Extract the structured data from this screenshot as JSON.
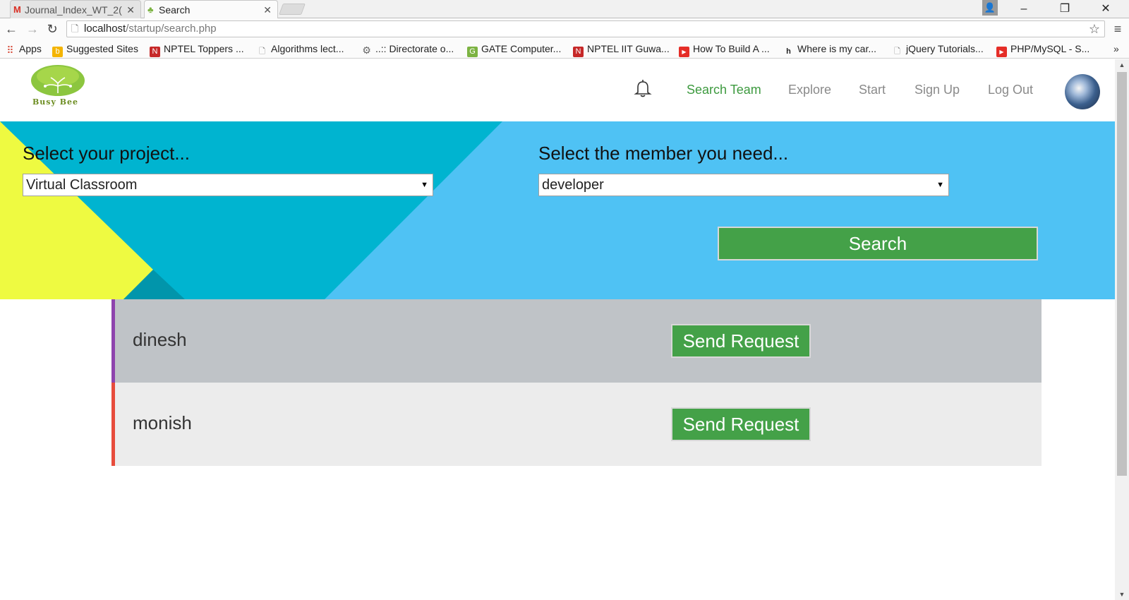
{
  "browser": {
    "tabs": [
      {
        "title": "Journal_Index_WT_2(",
        "icon": "gmail-icon",
        "active": false
      },
      {
        "title": "Search",
        "icon": "tree-icon",
        "active": true
      }
    ],
    "url_host": "localhost",
    "url_path": "/startup/search.php",
    "bookmarks": [
      {
        "label": "Apps",
        "icon": "apps-grid-icon",
        "color": "#d64937"
      },
      {
        "label": "Suggested Sites",
        "icon": "bing-icon",
        "color": "#f4b400"
      },
      {
        "label": "NPTEL Toppers ...",
        "icon": "nptel-icon",
        "color": "#c62828"
      },
      {
        "label": "Algorithms lect...",
        "icon": "page-icon",
        "color": "#9e9e9e"
      },
      {
        "label": "..:: Directorate o...",
        "icon": "gear-icon",
        "color": "#777777"
      },
      {
        "label": "GATE Computer...",
        "icon": "gate-icon",
        "color": "#7cb342"
      },
      {
        "label": "NPTEL IIT Guwa...",
        "icon": "nptel-icon",
        "color": "#c62828"
      },
      {
        "label": "How To Build A ...",
        "icon": "youtube-icon",
        "color": "#e52d27"
      },
      {
        "label": "Where is my car...",
        "icon": "stackexchange-icon",
        "color": "#222222"
      },
      {
        "label": "jQuery Tutorials...",
        "icon": "page-icon",
        "color": "#9e9e9e"
      },
      {
        "label": "PHP/MySQL - S...",
        "icon": "youtube-icon",
        "color": "#e52d27"
      }
    ],
    "more": "»"
  },
  "site": {
    "logo_text": "Busy Bee",
    "nav": [
      {
        "label": "Search Team",
        "active": true
      },
      {
        "label": "Explore",
        "active": false
      },
      {
        "label": "Start",
        "active": false
      },
      {
        "label": "Sign Up",
        "active": false
      },
      {
        "label": "Log Out",
        "active": false
      }
    ],
    "accent": "#3d9a3f"
  },
  "search": {
    "project_label": "Select your project...",
    "project_value": "Virtual Classroom",
    "member_label": "Select the member you need...",
    "member_value": "developer",
    "button": "Search"
  },
  "results": [
    {
      "name": "dinesh",
      "action": "Send Request",
      "bar_color": "#8e44ad",
      "bg": "#bfc3c7"
    },
    {
      "name": "monish",
      "action": "Send Request",
      "bar_color": "#e74c3c",
      "bg": "#ececec"
    }
  ]
}
